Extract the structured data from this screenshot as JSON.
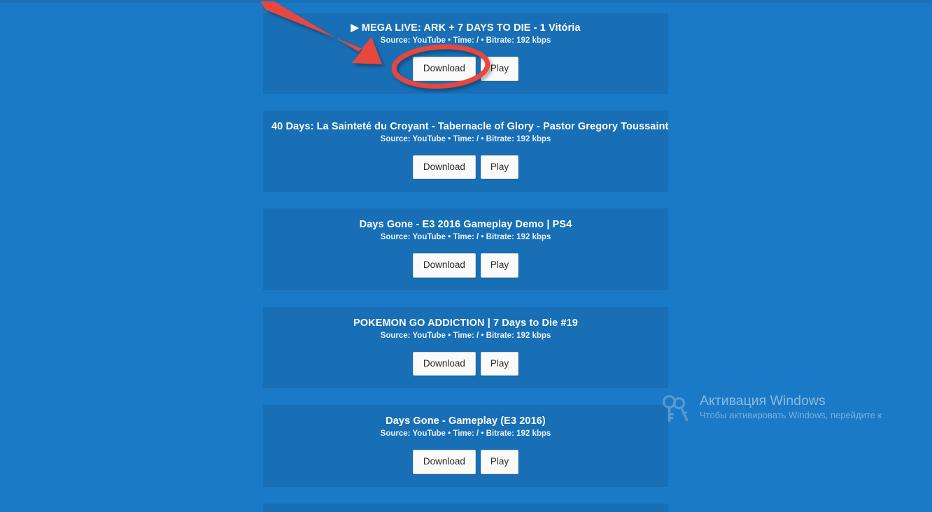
{
  "theme": {
    "page_background": "#1a7ac7",
    "card_background": "#186fb5",
    "button_background": "#fafafa",
    "button_text": "#2b2b2b",
    "annotation_red": "#e8463c",
    "title_text": "#ffffff",
    "meta_text": "#e8f1fa"
  },
  "buttons": {
    "download_label": "Download",
    "play_label": "Play"
  },
  "results": [
    {
      "title": "▶ MEGA LIVE: ARK + 7 DAYS TO DIE - 1 Vitória",
      "source_label": "Source:",
      "source": "YouTube",
      "time_label": "Time:",
      "time": "/",
      "bitrate_label": "Bitrate:",
      "bitrate": "192 kbps",
      "meta": "Source: YouTube • Time: / • Bitrate: 192 kbps",
      "download_label": "Download",
      "play_label": "Play"
    },
    {
      "title": "40 Days: La Sainteté du Croyant - Tabernacle of Glory - Pastor Gregory Toussaint",
      "source_label": "Source:",
      "source": "YouTube",
      "time_label": "Time:",
      "time": "/",
      "bitrate_label": "Bitrate:",
      "bitrate": "192 kbps",
      "meta": "Source: YouTube • Time: / • Bitrate: 192 kbps",
      "download_label": "Download",
      "play_label": "Play"
    },
    {
      "title": "Days Gone - E3 2016 Gameplay Demo | PS4",
      "source_label": "Source:",
      "source": "YouTube",
      "time_label": "Time:",
      "time": "/",
      "bitrate_label": "Bitrate:",
      "bitrate": "192 kbps",
      "meta": "Source: YouTube • Time: / • Bitrate: 192 kbps",
      "download_label": "Download",
      "play_label": "Play"
    },
    {
      "title": "POKEMON GO ADDICTION | 7 Days to Die #19",
      "source_label": "Source:",
      "source": "YouTube",
      "time_label": "Time:",
      "time": "/",
      "bitrate_label": "Bitrate:",
      "bitrate": "192 kbps",
      "meta": "Source: YouTube • Time: / • Bitrate: 192 kbps",
      "download_label": "Download",
      "play_label": "Play"
    },
    {
      "title": "Days Gone - Gameplay (E3 2016)",
      "source_label": "Source:",
      "source": "YouTube",
      "time_label": "Time:",
      "time": "/",
      "bitrate_label": "Bitrate:",
      "bitrate": "192 kbps",
      "meta": "Source: YouTube • Time: / • Bitrate: 192 kbps",
      "download_label": "Download",
      "play_label": "Play"
    }
  ],
  "annotations": {
    "arrow": {
      "color": "#e8463c",
      "points_to": "Download"
    },
    "ellipse": {
      "color": "#e8463c",
      "encircles": "Download"
    }
  },
  "windows_watermark": {
    "title": "Активация Windows",
    "subtitle": "Чтобы активировать Windows, перейдите к"
  }
}
